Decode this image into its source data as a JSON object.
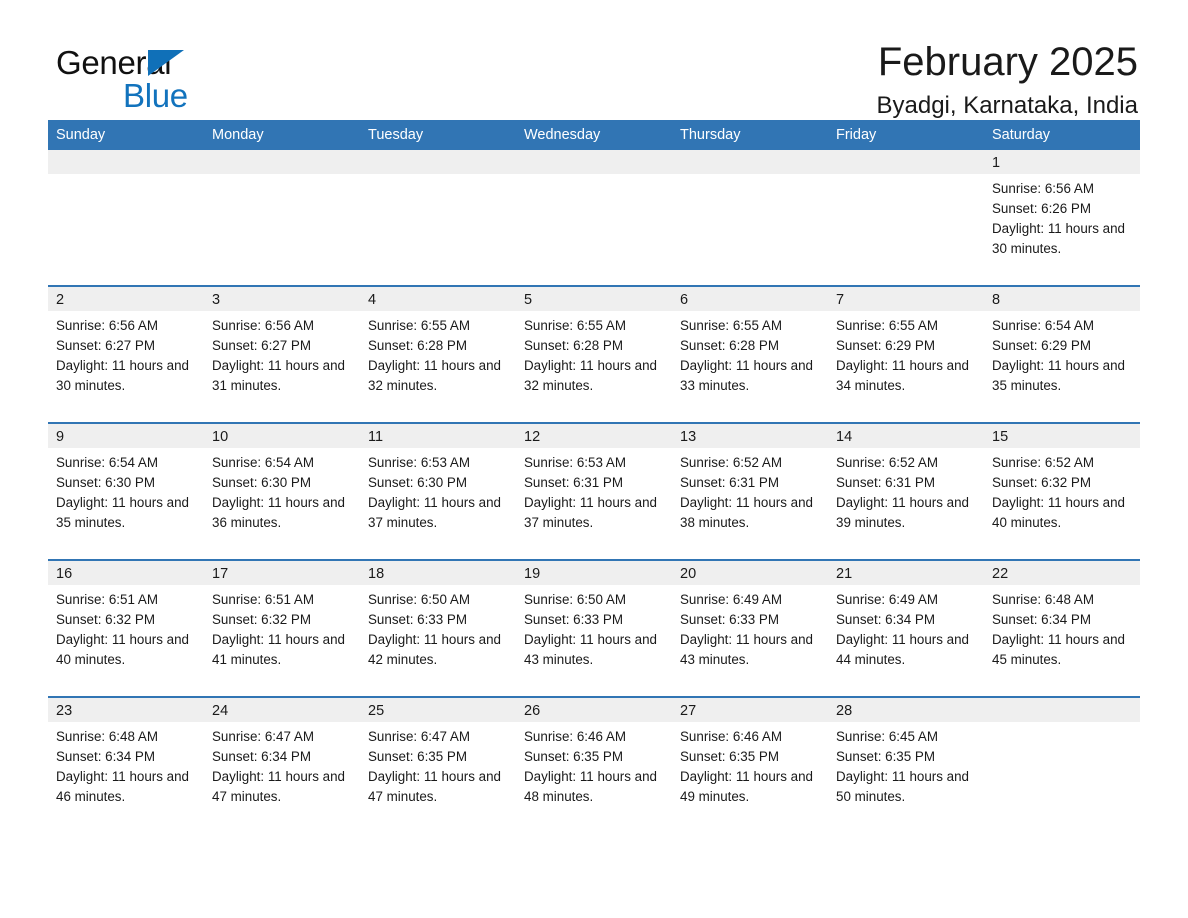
{
  "brand": {
    "name_line1": "General",
    "name_line2": "Blue",
    "triangle_color": "#1070b8",
    "blue_text_color": "#1273bd"
  },
  "header": {
    "month_title": "February 2025",
    "location": "Byadgi, Karnataka, India"
  },
  "colors": {
    "header_blue": "#3175b4",
    "daynum_band": "#efefef",
    "row_separator": "#3175b4",
    "text": "#1a1a1a"
  },
  "day_headers": [
    "Sunday",
    "Monday",
    "Tuesday",
    "Wednesday",
    "Thursday",
    "Friday",
    "Saturday"
  ],
  "weeks": [
    [
      {
        "day": "",
        "blank": true,
        "sunrise": "",
        "sunset": "",
        "daylight": ""
      },
      {
        "day": "",
        "blank": true,
        "sunrise": "",
        "sunset": "",
        "daylight": ""
      },
      {
        "day": "",
        "blank": true,
        "sunrise": "",
        "sunset": "",
        "daylight": ""
      },
      {
        "day": "",
        "blank": true,
        "sunrise": "",
        "sunset": "",
        "daylight": ""
      },
      {
        "day": "",
        "blank": true,
        "sunrise": "",
        "sunset": "",
        "daylight": ""
      },
      {
        "day": "",
        "blank": true,
        "sunrise": "",
        "sunset": "",
        "daylight": ""
      },
      {
        "day": "1",
        "blank": false,
        "sunrise": "Sunrise: 6:56 AM",
        "sunset": "Sunset: 6:26 PM",
        "daylight": "Daylight: 11 hours and 30 minutes."
      }
    ],
    [
      {
        "day": "2",
        "blank": false,
        "sunrise": "Sunrise: 6:56 AM",
        "sunset": "Sunset: 6:27 PM",
        "daylight": "Daylight: 11 hours and 30 minutes."
      },
      {
        "day": "3",
        "blank": false,
        "sunrise": "Sunrise: 6:56 AM",
        "sunset": "Sunset: 6:27 PM",
        "daylight": "Daylight: 11 hours and 31 minutes."
      },
      {
        "day": "4",
        "blank": false,
        "sunrise": "Sunrise: 6:55 AM",
        "sunset": "Sunset: 6:28 PM",
        "daylight": "Daylight: 11 hours and 32 minutes."
      },
      {
        "day": "5",
        "blank": false,
        "sunrise": "Sunrise: 6:55 AM",
        "sunset": "Sunset: 6:28 PM",
        "daylight": "Daylight: 11 hours and 32 minutes."
      },
      {
        "day": "6",
        "blank": false,
        "sunrise": "Sunrise: 6:55 AM",
        "sunset": "Sunset: 6:28 PM",
        "daylight": "Daylight: 11 hours and 33 minutes."
      },
      {
        "day": "7",
        "blank": false,
        "sunrise": "Sunrise: 6:55 AM",
        "sunset": "Sunset: 6:29 PM",
        "daylight": "Daylight: 11 hours and 34 minutes."
      },
      {
        "day": "8",
        "blank": false,
        "sunrise": "Sunrise: 6:54 AM",
        "sunset": "Sunset: 6:29 PM",
        "daylight": "Daylight: 11 hours and 35 minutes."
      }
    ],
    [
      {
        "day": "9",
        "blank": false,
        "sunrise": "Sunrise: 6:54 AM",
        "sunset": "Sunset: 6:30 PM",
        "daylight": "Daylight: 11 hours and 35 minutes."
      },
      {
        "day": "10",
        "blank": false,
        "sunrise": "Sunrise: 6:54 AM",
        "sunset": "Sunset: 6:30 PM",
        "daylight": "Daylight: 11 hours and 36 minutes."
      },
      {
        "day": "11",
        "blank": false,
        "sunrise": "Sunrise: 6:53 AM",
        "sunset": "Sunset: 6:30 PM",
        "daylight": "Daylight: 11 hours and 37 minutes."
      },
      {
        "day": "12",
        "blank": false,
        "sunrise": "Sunrise: 6:53 AM",
        "sunset": "Sunset: 6:31 PM",
        "daylight": "Daylight: 11 hours and 37 minutes."
      },
      {
        "day": "13",
        "blank": false,
        "sunrise": "Sunrise: 6:52 AM",
        "sunset": "Sunset: 6:31 PM",
        "daylight": "Daylight: 11 hours and 38 minutes."
      },
      {
        "day": "14",
        "blank": false,
        "sunrise": "Sunrise: 6:52 AM",
        "sunset": "Sunset: 6:31 PM",
        "daylight": "Daylight: 11 hours and 39 minutes."
      },
      {
        "day": "15",
        "blank": false,
        "sunrise": "Sunrise: 6:52 AM",
        "sunset": "Sunset: 6:32 PM",
        "daylight": "Daylight: 11 hours and 40 minutes."
      }
    ],
    [
      {
        "day": "16",
        "blank": false,
        "sunrise": "Sunrise: 6:51 AM",
        "sunset": "Sunset: 6:32 PM",
        "daylight": "Daylight: 11 hours and 40 minutes."
      },
      {
        "day": "17",
        "blank": false,
        "sunrise": "Sunrise: 6:51 AM",
        "sunset": "Sunset: 6:32 PM",
        "daylight": "Daylight: 11 hours and 41 minutes."
      },
      {
        "day": "18",
        "blank": false,
        "sunrise": "Sunrise: 6:50 AM",
        "sunset": "Sunset: 6:33 PM",
        "daylight": "Daylight: 11 hours and 42 minutes."
      },
      {
        "day": "19",
        "blank": false,
        "sunrise": "Sunrise: 6:50 AM",
        "sunset": "Sunset: 6:33 PM",
        "daylight": "Daylight: 11 hours and 43 minutes."
      },
      {
        "day": "20",
        "blank": false,
        "sunrise": "Sunrise: 6:49 AM",
        "sunset": "Sunset: 6:33 PM",
        "daylight": "Daylight: 11 hours and 43 minutes."
      },
      {
        "day": "21",
        "blank": false,
        "sunrise": "Sunrise: 6:49 AM",
        "sunset": "Sunset: 6:34 PM",
        "daylight": "Daylight: 11 hours and 44 minutes."
      },
      {
        "day": "22",
        "blank": false,
        "sunrise": "Sunrise: 6:48 AM",
        "sunset": "Sunset: 6:34 PM",
        "daylight": "Daylight: 11 hours and 45 minutes."
      }
    ],
    [
      {
        "day": "23",
        "blank": false,
        "sunrise": "Sunrise: 6:48 AM",
        "sunset": "Sunset: 6:34 PM",
        "daylight": "Daylight: 11 hours and 46 minutes."
      },
      {
        "day": "24",
        "blank": false,
        "sunrise": "Sunrise: 6:47 AM",
        "sunset": "Sunset: 6:34 PM",
        "daylight": "Daylight: 11 hours and 47 minutes."
      },
      {
        "day": "25",
        "blank": false,
        "sunrise": "Sunrise: 6:47 AM",
        "sunset": "Sunset: 6:35 PM",
        "daylight": "Daylight: 11 hours and 47 minutes."
      },
      {
        "day": "26",
        "blank": false,
        "sunrise": "Sunrise: 6:46 AM",
        "sunset": "Sunset: 6:35 PM",
        "daylight": "Daylight: 11 hours and 48 minutes."
      },
      {
        "day": "27",
        "blank": false,
        "sunrise": "Sunrise: 6:46 AM",
        "sunset": "Sunset: 6:35 PM",
        "daylight": "Daylight: 11 hours and 49 minutes."
      },
      {
        "day": "28",
        "blank": false,
        "sunrise": "Sunrise: 6:45 AM",
        "sunset": "Sunset: 6:35 PM",
        "daylight": "Daylight: 11 hours and 50 minutes."
      },
      {
        "day": "",
        "blank": true,
        "sunrise": "",
        "sunset": "",
        "daylight": ""
      }
    ]
  ]
}
